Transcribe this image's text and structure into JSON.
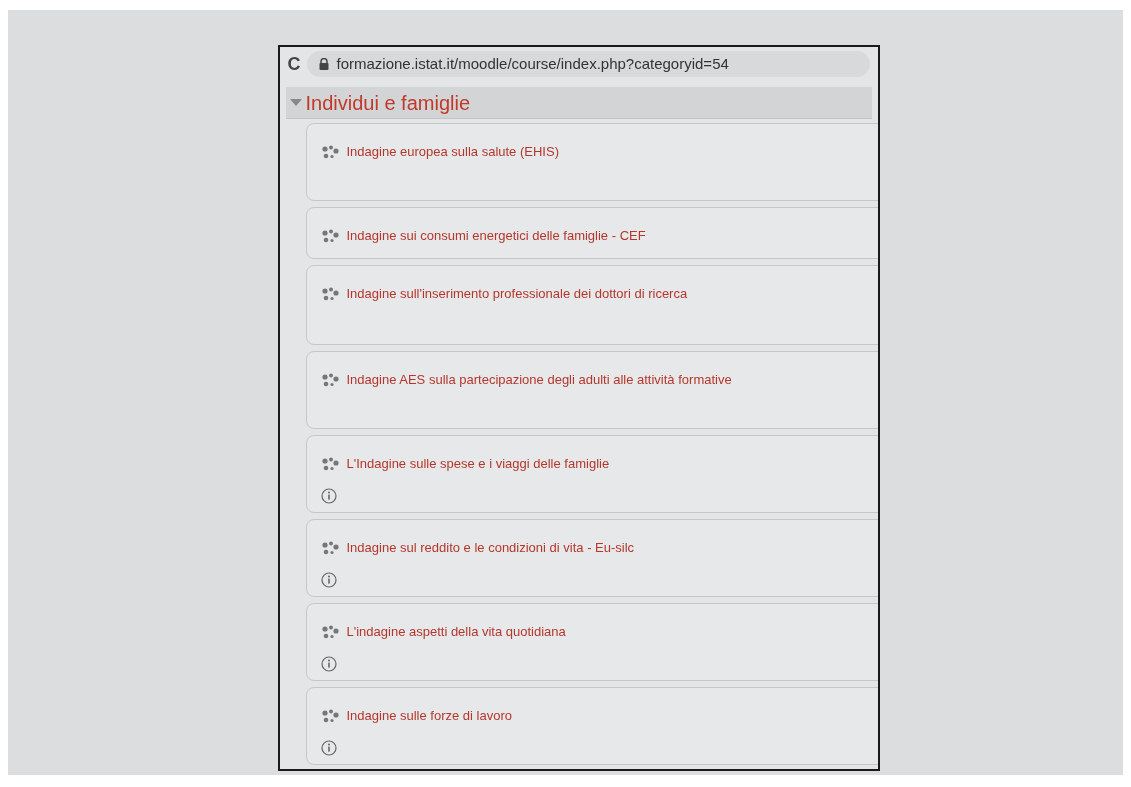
{
  "browser": {
    "reload": "C",
    "url": "formazione.istat.it/moodle/course/index.php?categoryid=54"
  },
  "category": {
    "title": "Individui e famiglie",
    "expanded": true
  },
  "courses": [
    {
      "title": "Indagine europea sulla salute (EHIS)",
      "info": false
    },
    {
      "title": "Indagine sui consumi energetici delle famiglie - CEF",
      "info": false
    },
    {
      "title": "Indagine sull'inserimento professionale dei dottori di ricerca",
      "info": false
    },
    {
      "title": "Indagine AES sulla partecipazione degli adulti alle attività formative",
      "info": false
    },
    {
      "title": "L'Indagine sulle spese e i viaggi delle famiglie",
      "info": true
    },
    {
      "title": "Indagine sul reddito e le condizioni di vita - Eu-silc",
      "info": true
    },
    {
      "title": "L'indagine aspetti della vita quotidiana",
      "info": true
    },
    {
      "title": "Indagine sulle forze di lavoro",
      "info": true
    }
  ]
}
